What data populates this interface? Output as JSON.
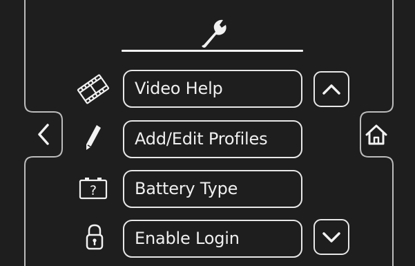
{
  "menu": {
    "items": [
      {
        "label": "Video Help",
        "icon": "film-icon"
      },
      {
        "label": "Add/Edit Profiles",
        "icon": "pencil-icon"
      },
      {
        "label": "Battery Type",
        "icon": "battery-question-icon"
      },
      {
        "label": "Enable Login",
        "icon": "padlock-icon"
      }
    ]
  },
  "header": {
    "icon": "wrench-icon"
  },
  "nav": {
    "back_icon": "chevron-left-icon",
    "home_icon": "home-icon",
    "scroll_up_icon": "chevron-up-icon",
    "scroll_down_icon": "chevron-down-icon"
  },
  "colors": {
    "background": "#1e1e1e",
    "foreground": "#f0f0f0",
    "frame": "#c8c8c8"
  }
}
